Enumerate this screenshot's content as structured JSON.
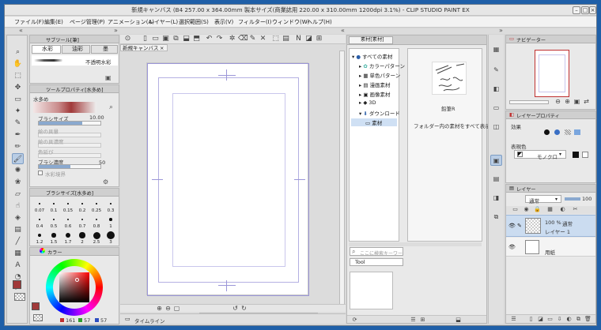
{
  "window": {
    "title": "新規キャンバス (B4 257.00 x 364.00mm 製本サイズ(商業誌用 220.00 x 310.00mm 1200dpi 3.1%) - CLIP STUDIO PAINT EX"
  },
  "menu": [
    "ファイル(F)",
    "編集(E)",
    "ページ管理(P)",
    "アニメーション(A)",
    "レイヤー(L)",
    "選択範囲(S)",
    "表示(V)",
    "フィルター(I)",
    "ウィンドウ(W)",
    "ヘルプ(H)"
  ],
  "subtool": {
    "header": "サブツール[筆]",
    "tabs": [
      "水彩",
      "油彩",
      "墨"
    ],
    "current_brush": "不透明水彩"
  },
  "toolprop": {
    "header": "ツールプロパティ[水多め]",
    "name": "水多め",
    "brush_size_label": "ブラシサイズ",
    "brush_size": "10.00",
    "paint_amount": "絵の具量",
    "paint_density": "絵の具濃度",
    "blur": "色延び",
    "brush_density_label": "ブラシ濃度",
    "brush_density": "50",
    "watercolor_edge": "水彩境界"
  },
  "brushsize": {
    "header": "ブラシサイズ[水多め]",
    "sizes": [
      "0.07",
      "0.1",
      "0.15",
      "0.2",
      "0.25",
      "0.3",
      "0.4",
      "0.5",
      "0.6",
      "0.7",
      "0.8",
      "1",
      "1.2",
      "1.5",
      "1.7",
      "2",
      "2.5",
      "3"
    ]
  },
  "color": {
    "tab": "カラー",
    "r": "161",
    "g": "57",
    "b": "57",
    "main_hex": "#a13939"
  },
  "canvas": {
    "tab": "新規キャンバス"
  },
  "timeline": {
    "label": "タイムライン"
  },
  "material": {
    "tab": "素材[素材]",
    "tree": [
      "すべての素材",
      "カラーパターン",
      "単色パターン",
      "漫画素材",
      "画像素材",
      "3D",
      "ダウンロード",
      "素材"
    ],
    "item_label": "鉛筆R",
    "hint": "フォルダー内の素材をすべて表示",
    "search_placeholder": "ここに検索キーワード",
    "tag": "Tool"
  },
  "navigator": {
    "tab": "ナビゲーター"
  },
  "layerprop": {
    "tab": "レイヤープロパティ",
    "effect": "効果",
    "expression_color": "表現色",
    "mono": "モノクロ"
  },
  "layers": {
    "tab": "レイヤー",
    "blend": "通常",
    "opacity": "100",
    "items": [
      {
        "pct": "100 %",
        "mode": "通常",
        "name": "レイヤー 1"
      },
      {
        "pct": "",
        "mode": "",
        "name": "用紙"
      }
    ]
  }
}
